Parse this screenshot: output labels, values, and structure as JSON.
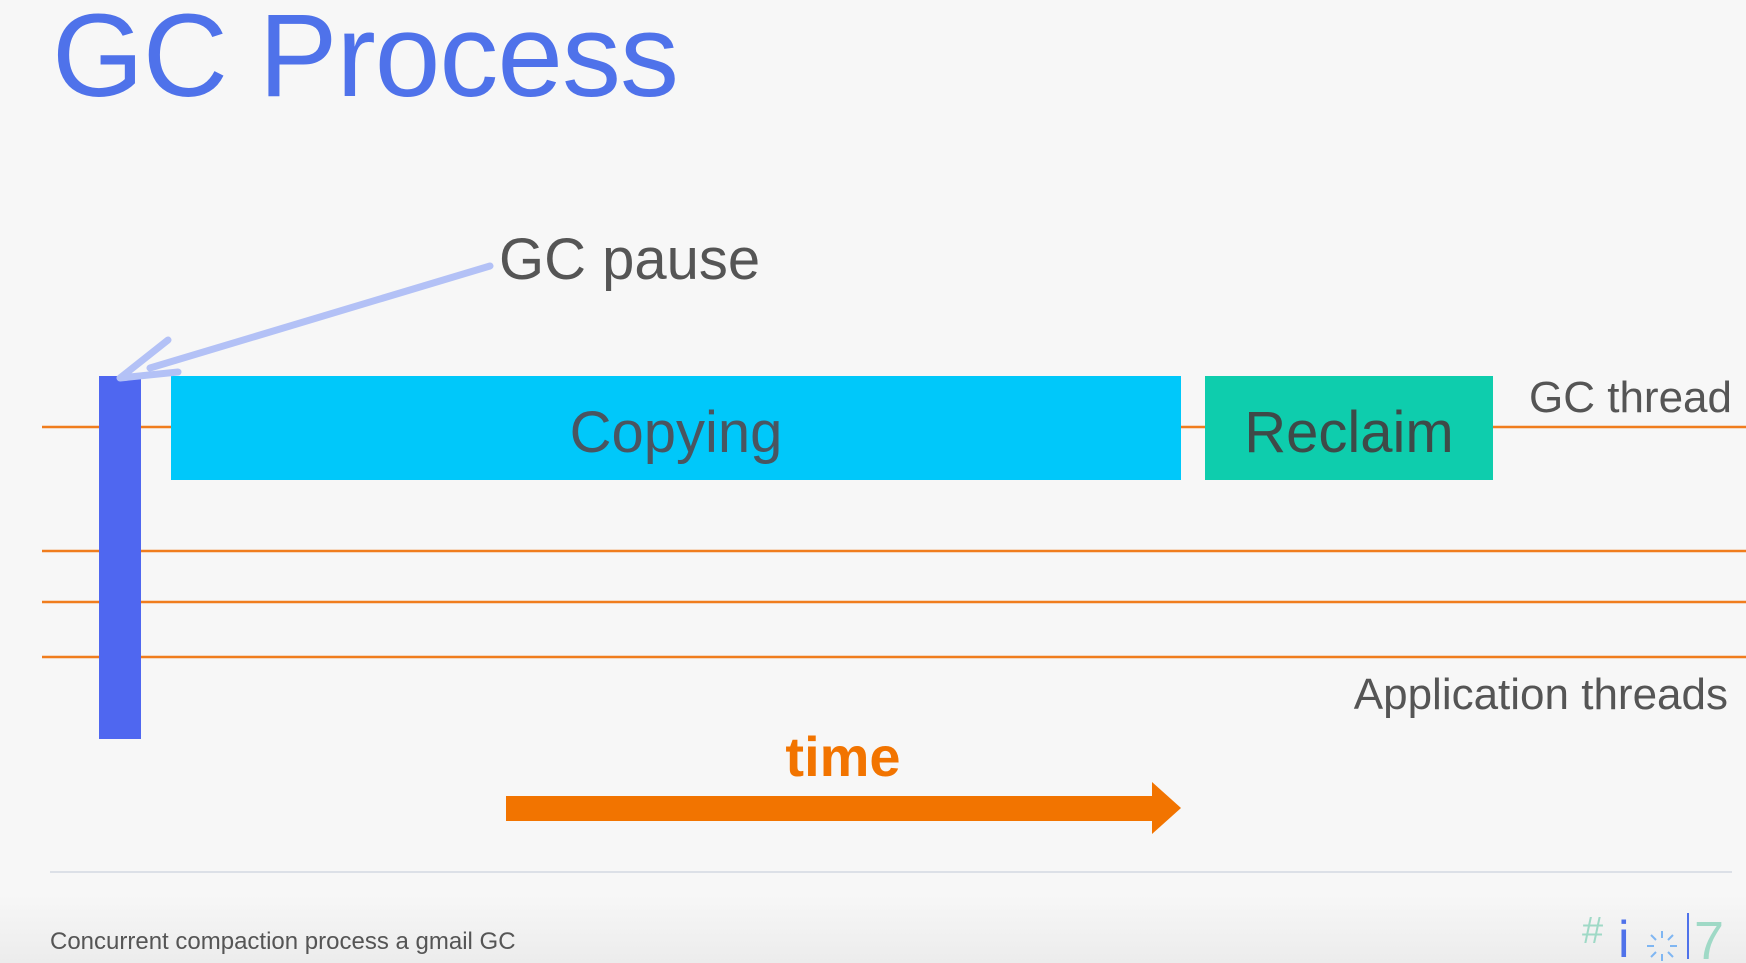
{
  "slide": {
    "title": "GC Process",
    "caption": "Concurrent compaction process a gmail GC"
  },
  "diagram": {
    "pause_label": "GC pause",
    "gc_thread_label": "GC thread",
    "application_threads_label": "Application threads",
    "copying_label": "Copying",
    "reclaim_label": "Reclaim",
    "time_label": "time"
  },
  "logo": {
    "hash_glyph": "#",
    "letter_i": "i",
    "digit_7": "7"
  },
  "colors": {
    "title": "#4f72ea",
    "pause_bar": "#4f67f0",
    "copying": "#00c8fa",
    "reclaim": "#0ecdad",
    "thread_line": "#f07d1e",
    "time_arrow": "#f27400",
    "pause_arrow": "#b3c1f6"
  }
}
